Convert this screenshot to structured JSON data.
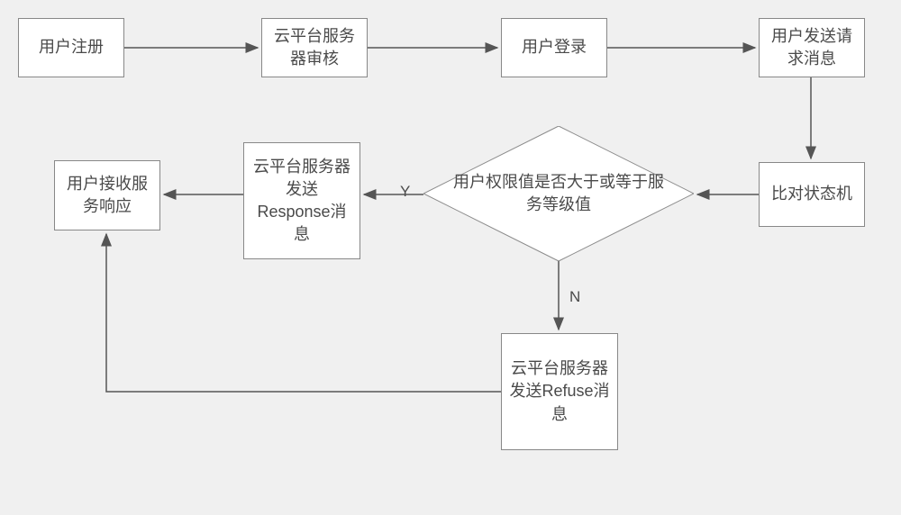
{
  "chart_data": {
    "type": "flowchart",
    "title": "",
    "nodes": [
      {
        "id": "register",
        "shape": "rect",
        "label": "用户注册"
      },
      {
        "id": "audit",
        "shape": "rect",
        "label": "云平台服务器审核"
      },
      {
        "id": "login",
        "shape": "rect",
        "label": "用户登录"
      },
      {
        "id": "send_req",
        "shape": "rect",
        "label": "用户发送请求消息"
      },
      {
        "id": "compare",
        "shape": "rect",
        "label": "比对状态机"
      },
      {
        "id": "decision",
        "shape": "diamond",
        "label": "用户权限值是否大于或等于服务等级值"
      },
      {
        "id": "response",
        "shape": "rect",
        "label": "云平台服务器发送Response消息"
      },
      {
        "id": "refuse",
        "shape": "rect",
        "label": "云平台服务器发送Refuse消息"
      },
      {
        "id": "receive",
        "shape": "rect",
        "label": "用户接收服务响应"
      }
    ],
    "edges": [
      {
        "from": "register",
        "to": "audit",
        "label": ""
      },
      {
        "from": "audit",
        "to": "login",
        "label": ""
      },
      {
        "from": "login",
        "to": "send_req",
        "label": ""
      },
      {
        "from": "send_req",
        "to": "compare",
        "label": ""
      },
      {
        "from": "compare",
        "to": "decision",
        "label": ""
      },
      {
        "from": "decision",
        "to": "response",
        "label": "Y"
      },
      {
        "from": "decision",
        "to": "refuse",
        "label": "N"
      },
      {
        "from": "response",
        "to": "receive",
        "label": ""
      },
      {
        "from": "refuse",
        "to": "receive",
        "label": ""
      }
    ]
  },
  "labels": {
    "Y": "Y",
    "N": "N"
  },
  "boxes": {
    "register": "用户注册",
    "audit": "云平台服务器审核",
    "login": "用户登录",
    "send_req": "用户发送请求消息",
    "compare": "比对状态机",
    "decision": "用户权限值是否大于或等于服务等级值",
    "response": "云平台服务器发送Response消息",
    "refuse": "云平台服务器发送Refuse消息",
    "receive": "用户接收服务响应"
  }
}
